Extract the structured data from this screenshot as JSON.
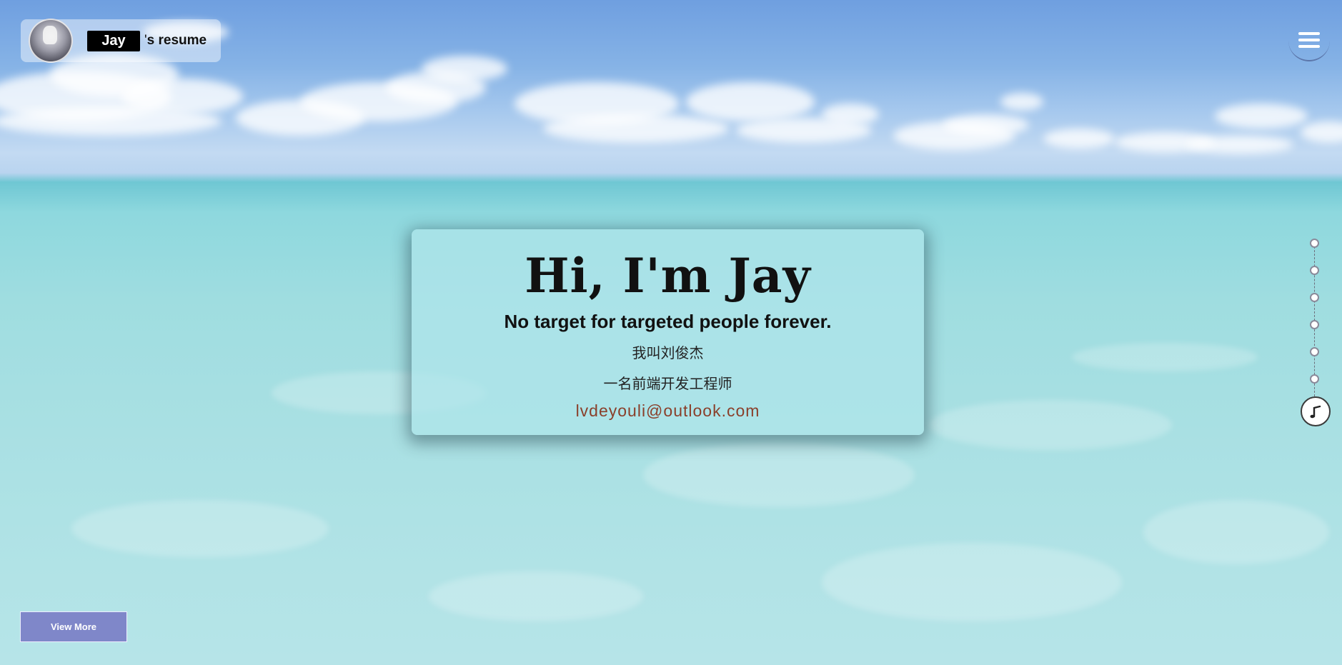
{
  "header": {
    "name": "Jay",
    "title_suffix_apostrophe": "'",
    "title_suffix_word": "s resume",
    "avatar_icon": "avatar-icon",
    "menu_icon": "hamburger-menu-icon"
  },
  "hero": {
    "heading": "Hi, I'm Jay",
    "motto": "No target for targeted people forever.",
    "cn_name": "我叫刘俊杰",
    "cn_role": "一名前端开发工程师",
    "email": "lvdeyouli@outlook.com"
  },
  "side_nav": {
    "dot_count": 6,
    "music_icon": "music-note-icon"
  },
  "footer": {
    "view_more_label": "View More"
  },
  "colors": {
    "accent_button": "#7f87c9",
    "email_text": "#8a3f2a",
    "name_tag_bg": "#000000"
  }
}
